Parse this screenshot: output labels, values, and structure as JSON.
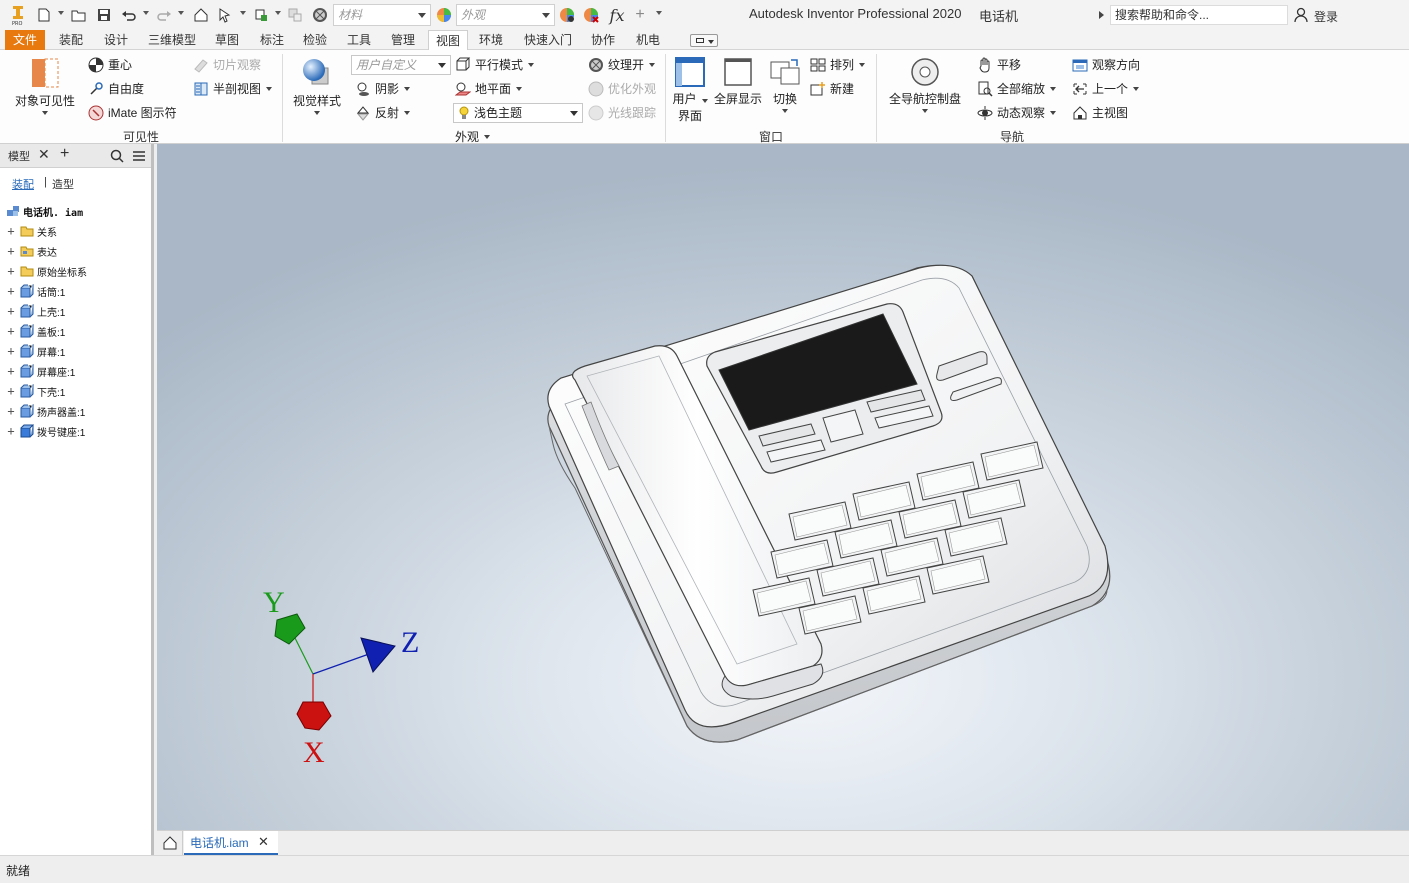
{
  "app": {
    "title": "Autodesk Inventor Professional 2020",
    "document_name": "电话机",
    "search_placeholder": "搜索帮助和命令...",
    "login": "登录",
    "material_combo": "材料",
    "appearance_combo": "外观",
    "fx_label": "fx"
  },
  "tabs": {
    "file": "文件",
    "items": [
      "装配",
      "设计",
      "三维模型",
      "草图",
      "标注",
      "检验",
      "工具",
      "管理",
      "视图",
      "环境",
      "快速入门",
      "协作",
      "机电"
    ],
    "active": "视图"
  },
  "ribbon": {
    "visibility": {
      "object_visibility": "对象可见性",
      "center_of_gravity": "重心",
      "dof": "自由度",
      "imate": "iMate 图示符",
      "slice_graphics": "切片观察",
      "half_section": "半剖视图",
      "label": "可见性"
    },
    "appearance": {
      "visual_style": "视觉样式",
      "custom_combo": "用户自定义",
      "shadows": "阴影",
      "reflections": "反射",
      "theme_combo": "浅色主题",
      "parallel": "平行模式",
      "ground_plane": "地平面",
      "texture_on": "纹理开",
      "optimize_appearance": "优化外观",
      "ray_tracing": "光线跟踪",
      "label": "外观"
    },
    "window": {
      "user_interface_line1": "用户",
      "user_interface_line2": "界面",
      "full_screen": "全屏显示",
      "switch": "切换",
      "arrange": "排列",
      "new": "新建",
      "label": "窗口"
    },
    "navigate": {
      "full_nav_wheel": "全导航控制盘",
      "pan": "平移",
      "zoom_all": "全部缩放",
      "orbit": "动态观察",
      "look_at": "观察方向",
      "previous": "上一个",
      "home_view": "主视图",
      "label": "导航"
    }
  },
  "browser": {
    "title": "模型",
    "tab_assembly": "装配",
    "tab_modeling": "造型",
    "root": "电话机. iam",
    "items": [
      {
        "label": "关系",
        "icon": "folder-icon"
      },
      {
        "label": "表达",
        "icon": "representations-icon"
      },
      {
        "label": "原始坐标系",
        "icon": "folder-icon"
      },
      {
        "label": "话筒:1",
        "icon": "part-icon"
      },
      {
        "label": "上壳:1",
        "icon": "part-icon"
      },
      {
        "label": "盖板:1",
        "icon": "part-icon"
      },
      {
        "label": "屏幕:1",
        "icon": "part-icon"
      },
      {
        "label": "屏幕座:1",
        "icon": "part-icon"
      },
      {
        "label": "下壳:1",
        "icon": "part-icon"
      },
      {
        "label": "扬声器盖:1",
        "icon": "part-icon"
      },
      {
        "label": "拨号键座:1",
        "icon": "part-solid-icon"
      }
    ]
  },
  "viewport": {
    "axis_x": "X",
    "axis_y": "Y",
    "axis_z": "Z",
    "colors": {
      "x": "#cc1111",
      "y": "#1a9a1a",
      "z": "#1020b0"
    }
  },
  "doc_tab": {
    "label": "电话机.iam"
  },
  "status": {
    "text": "就绪"
  }
}
